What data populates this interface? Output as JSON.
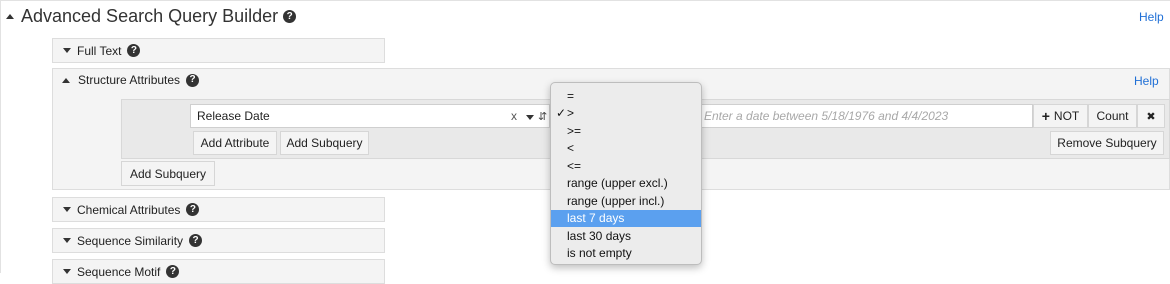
{
  "builder": {
    "title": "Advanced Search Query Builder",
    "help": "Help"
  },
  "sections": {
    "full_text": "Full Text",
    "structure": "Structure Attributes",
    "structure_help": "Help",
    "chemical": "Chemical Attributes",
    "sequence_similarity": "Sequence Similarity",
    "sequence_motif": "Sequence Motif"
  },
  "attribute_row": {
    "field_value": "Release Date",
    "clear": "x",
    "date_placeholder": "Enter a date between 5/18/1976 and 4/4/2023",
    "not_label": "NOT",
    "count_label": "Count",
    "remove": "✖"
  },
  "actions": {
    "add_attribute": "Add Attribute",
    "add_subquery_inner": "Add Subquery",
    "remove_subquery": "Remove Subquery",
    "add_subquery_outer": "Add Subquery"
  },
  "operator_menu": {
    "selected_check": "✓",
    "options": [
      "=",
      ">",
      ">=",
      "<",
      "<=",
      "range (upper excl.)",
      "range (upper incl.)",
      "last 7 days",
      "last 30 days",
      "is not empty"
    ],
    "checked_index": 1,
    "highlighted_index": 7
  },
  "colors": {
    "help_link": "#1f6fd6",
    "highlight": "#5ba0ef"
  }
}
